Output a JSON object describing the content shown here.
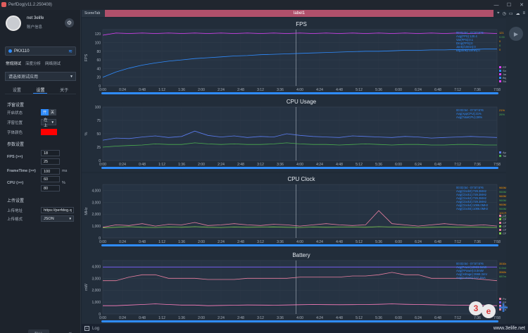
{
  "window": {
    "title": "PerfDog(v11.2.250408)",
    "min": "—",
    "max": "☐",
    "close": "✕"
  },
  "user": {
    "name": "net 3elife",
    "account": "账户信息"
  },
  "device": {
    "name": "PKX110"
  },
  "modes": [
    "常规测试",
    "深度分析",
    "网络测试"
  ],
  "app_select": {
    "placeholder": "请选择测试应用"
  },
  "tabs": [
    "设置",
    "设置",
    "关于"
  ],
  "float": {
    "title": "浮窗设置",
    "open_label": "开启状态",
    "on": "开",
    "off": "关",
    "position_label": "浮窗位置",
    "position_value": "左上",
    "color_label": "字体颜色",
    "color_value": "#ff0000"
  },
  "params": {
    "title": "参数设置",
    "fps_label": "FPS (>=)",
    "fps_values": [
      "18",
      "25"
    ],
    "frametime_label": "FrameTime (>=)",
    "frametime_value": "100",
    "frametime_unit": "ms",
    "cpu_label": "CPU (>=)",
    "cpu_values": [
      "60",
      "80"
    ],
    "cpu_unit": "%"
  },
  "upload": {
    "title": "上传设置",
    "addr_label": "上传地址",
    "addr_value": "https://perfdog.q",
    "format_label": "上传格式",
    "format_value": "JSON"
  },
  "default_button": "默认",
  "main": {
    "scene_tab": "SceneTab",
    "label_bar": "label1",
    "log": "Log"
  },
  "colors": {
    "accent": "#2f8cff",
    "label_bar": "#b0506b",
    "fps": "#e040fb",
    "green": "#4caf50"
  },
  "charts": [
    {
      "type": "line",
      "title": "FPS",
      "ylabel": "FPS",
      "yticks": [
        0,
        20,
        40,
        60,
        80,
        100,
        120
      ],
      "legend_text": [
        "00:01:54 - 07:57:6?6",
        "Avg(FPS):120.4",
        "Var(FPS):0.1",
        "Drop(FPS):0",
        "Jank(/10min):0",
        "BigJank(/10min):0"
      ],
      "legend_values": [
        "121",
        "0.00",
        "0",
        "0",
        "0"
      ],
      "legend_series": [
        "FPS",
        "Smooth(滑动评价)",
        "Jank(卡顿次数)",
        "BigJank(严重卡顿)",
        "Stutter(卡顿率)"
      ],
      "series": [
        {
          "name": "FPS",
          "values": [
            117,
            122,
            121,
            122,
            121,
            122,
            121,
            122,
            121,
            122,
            121,
            122,
            121,
            122,
            121,
            122,
            121,
            122,
            121,
            122,
            121,
            122,
            121,
            122,
            121,
            122,
            121,
            122,
            121,
            122,
            121
          ]
        },
        {
          "name": "Smooth",
          "values": [
            20,
            32,
            41,
            48,
            53,
            57,
            60,
            63,
            65,
            67,
            69,
            70,
            72,
            73,
            74,
            75,
            76,
            77,
            78,
            79,
            80,
            80,
            81,
            82,
            82,
            83,
            83,
            84,
            84,
            85,
            85
          ]
        }
      ]
    },
    {
      "type": "line",
      "title": "CPU Usage",
      "ylabel": "%",
      "yticks": [
        0,
        25,
        50,
        75,
        100
      ],
      "legend_text": [
        "00:03:54 - 07:57:6?6",
        "Avg(AppCPU):21%",
        "Avg(TotalCPU):26%"
      ],
      "legend_values": [
        "21%",
        "26%"
      ],
      "legend_series": [
        "AppCPU",
        "TotalCPU"
      ],
      "series": [
        {
          "name": "TotalCPU",
          "values": [
            38,
            42,
            41,
            44,
            46,
            43,
            45,
            55,
            47,
            44,
            46,
            43,
            45,
            44,
            50,
            47,
            45,
            44,
            43,
            46,
            45,
            44,
            43,
            45,
            44,
            42,
            43,
            44,
            45,
            44,
            43
          ]
        },
        {
          "name": "AppCPU",
          "values": [
            25,
            27,
            28,
            29,
            31,
            30,
            30,
            33,
            31,
            30,
            31,
            30,
            30,
            31,
            33,
            31,
            30,
            30,
            29,
            30,
            31,
            30,
            29,
            30,
            30,
            29,
            29,
            30,
            30,
            29,
            29
          ]
        }
      ]
    },
    {
      "type": "line",
      "title": "CPU Clock",
      "ylabel": "MHz",
      "yticks": [
        0,
        1000,
        2000,
        3000,
        4000
      ],
      "legend_text": [
        "00:03:54 - 07:57:6?6",
        "Avg(Clock0):729.3MHz",
        "Avg(Clock1):729.3MHz",
        "Avg(Clock2):729.3MHz",
        "Avg(Clock3):729.3MHz",
        "Avg(Clock4):1086.0MHz",
        "Avg(Clock5):1086.0MHz"
      ],
      "legend_values": [
        "960MHz",
        "960MHz",
        "960MHz",
        "960MHz",
        "960MHz",
        "960MHz",
        "1017MHz",
        "1017MHz"
      ],
      "legend_series": [
        "CPU0",
        "CPU1",
        "CPU2",
        "CPU3",
        "CPU4",
        "CPU5"
      ],
      "series": [
        {
          "name": "CPU7",
          "values": [
            900,
            1100,
            1050,
            1200,
            1000,
            1150,
            1100,
            1300,
            1050,
            1100,
            1200,
            1100,
            1050,
            1150,
            1100,
            1000,
            1100,
            1200,
            1100,
            1050,
            1100,
            2300,
            1200,
            1100,
            1000,
            1100,
            1200,
            1100,
            1050,
            1100,
            1000
          ]
        },
        {
          "name": "CPU0",
          "values": [
            850,
            900,
            950,
            900,
            880,
            920,
            900,
            950,
            900,
            880,
            920,
            900,
            910,
            930,
            900,
            880,
            920,
            900,
            910,
            920,
            900,
            950,
            920,
            900,
            880,
            900,
            920,
            900,
            910,
            900,
            880
          ]
        }
      ]
    },
    {
      "type": "line",
      "title": "Battery",
      "ylabel": "mW",
      "yticks": [
        0,
        1000,
        2000,
        3000,
        4000
      ],
      "legend_text": [
        "00:03:54 - 07:57:6?6",
        "Avg(Power):2923.5mW",
        "Avg(FPower):0.0mW",
        "Avg(Voltage):3969.3mV",
        "Avg(Current):737.3mA"
      ],
      "legend_values": [
        "3530mW",
        "0.0mW",
        "3969mV",
        "887mA"
      ],
      "legend_series": [
        "Power",
        "FPower",
        "Voltage",
        "Current"
      ],
      "series": [
        {
          "name": "Power",
          "values": [
            2800,
            2800,
            3100,
            3300,
            3300,
            3000,
            3000,
            3000,
            2900,
            2900,
            2900,
            3000,
            3000,
            3000,
            3000,
            3100,
            3100,
            3100,
            3100,
            3200,
            3200,
            3300,
            3500,
            3300,
            3300,
            3000,
            3000,
            3000,
            3000,
            2900,
            2800
          ]
        },
        {
          "name": "Voltage",
          "values": [
            3950,
            3950,
            3950,
            3950,
            3950,
            3950,
            3950,
            3950,
            3950,
            3950,
            3950,
            3950,
            3950,
            3950,
            3950,
            3950,
            3950,
            3950,
            3950,
            3950,
            3950,
            3950,
            3950,
            3950,
            3950,
            3950,
            3950,
            3950,
            3950,
            3950,
            3950
          ]
        },
        {
          "name": "Current",
          "values": [
            700,
            700,
            750,
            800,
            850,
            800,
            750,
            750,
            700,
            720,
            740,
            760,
            750,
            740,
            760,
            780,
            800,
            790,
            780,
            790,
            800,
            820,
            850,
            820,
            800,
            780,
            760,
            740,
            730,
            720,
            700
          ]
        }
      ]
    }
  ],
  "chart_data": [
    {
      "type": "line",
      "title": "FPS",
      "xlabel": "",
      "ylabel": "FPS",
      "ylim": [
        0,
        130
      ],
      "x": [
        "0:00",
        "0:24",
        "0:48",
        "1:12",
        "1:36",
        "2:00",
        "2:24",
        "2:48",
        "3:12",
        "3:36",
        "4:00",
        "4:24",
        "4:48",
        "5:12",
        "5:36",
        "6:00",
        "6:24",
        "6:48",
        "7:12",
        "7:36",
        "7:58"
      ],
      "series": [
        {
          "name": "FPS",
          "values": [
            117,
            122,
            121,
            122,
            121,
            122,
            121,
            122,
            121,
            122,
            121,
            122,
            121,
            122,
            121,
            122,
            121,
            122,
            121,
            122,
            121
          ]
        },
        {
          "name": "Smooth(滑动评价)",
          "values": [
            20,
            41,
            53,
            60,
            65,
            69,
            72,
            74,
            76,
            78,
            79,
            80,
            81,
            82,
            83,
            83,
            84,
            84,
            85,
            85,
            85
          ]
        }
      ]
    },
    {
      "type": "line",
      "title": "CPU Usage",
      "ylabel": "%",
      "ylim": [
        0,
        100
      ],
      "x": [
        "0:00",
        "0:24",
        "0:48",
        "1:12",
        "1:36",
        "2:00",
        "2:24",
        "2:48",
        "3:12",
        "3:36",
        "4:00",
        "4:24",
        "4:48",
        "5:12",
        "5:36",
        "6:00",
        "6:24",
        "6:48",
        "7:12",
        "7:36",
        "7:58"
      ],
      "series": [
        {
          "name": "TotalCPU",
          "values": [
            38,
            42,
            46,
            45,
            55,
            44,
            45,
            44,
            50,
            45,
            44,
            43,
            45,
            44,
            43,
            44,
            45,
            44,
            43,
            44,
            43
          ]
        },
        {
          "name": "AppCPU",
          "values": [
            25,
            28,
            31,
            30,
            33,
            30,
            31,
            30,
            33,
            30,
            30,
            29,
            30,
            30,
            29,
            29,
            30,
            30,
            29,
            29,
            29
          ]
        }
      ]
    },
    {
      "type": "line",
      "title": "CPU Clock",
      "ylabel": "MHz",
      "ylim": [
        0,
        4500
      ],
      "x": [
        "0:00",
        "0:24",
        "0:48",
        "1:12",
        "1:36",
        "2:00",
        "2:24",
        "2:48",
        "3:12",
        "3:36",
        "4:00",
        "4:24",
        "4:48",
        "5:12",
        "5:36",
        "6:00",
        "6:24",
        "6:48",
        "7:12",
        "7:36",
        "7:58"
      ],
      "series": [
        {
          "name": "CPU0",
          "values": [
            850,
            950,
            880,
            900,
            950,
            880,
            900,
            930,
            900,
            920,
            900,
            910,
            920,
            950,
            920,
            900,
            880,
            900,
            910,
            900,
            880
          ]
        }
      ]
    },
    {
      "type": "line",
      "title": "Battery",
      "ylabel": "mW",
      "ylim": [
        0,
        4500
      ],
      "x": [
        "0:00",
        "0:24",
        "0:48",
        "1:12",
        "1:36",
        "2:00",
        "2:24",
        "2:48",
        "3:12",
        "3:36",
        "4:00",
        "4:24",
        "4:48",
        "5:12",
        "5:36",
        "6:00",
        "6:24",
        "6:48",
        "7:12",
        "7:36",
        "7:58"
      ],
      "series": [
        {
          "name": "Power",
          "values": [
            2800,
            3100,
            3300,
            3000,
            3000,
            2900,
            2900,
            3000,
            3000,
            3100,
            3100,
            3100,
            3200,
            3300,
            3500,
            3300,
            3300,
            3000,
            3000,
            2900,
            2800
          ]
        },
        {
          "name": "Voltage",
          "values": [
            3950,
            3950,
            3950,
            3950,
            3950,
            3950,
            3950,
            3950,
            3950,
            3950,
            3950,
            3950,
            3950,
            3950,
            3950,
            3950,
            3950,
            3950,
            3950,
            3950,
            3950
          ]
        },
        {
          "name": "Current",
          "values": [
            700,
            750,
            850,
            800,
            750,
            720,
            740,
            760,
            750,
            760,
            800,
            790,
            780,
            800,
            850,
            820,
            800,
            780,
            760,
            730,
            700
          ]
        }
      ]
    }
  ],
  "x_ticks": [
    "0:00",
    "0:24",
    "0:48",
    "1:12",
    "1:36",
    "2:00",
    "2:24",
    "2:48",
    "3:12",
    "3:36",
    "4:00",
    "4:24",
    "4:48",
    "5:12",
    "5:36",
    "6:00",
    "6:24",
    "6:48",
    "7:12",
    "7:36",
    "7:58"
  ]
}
